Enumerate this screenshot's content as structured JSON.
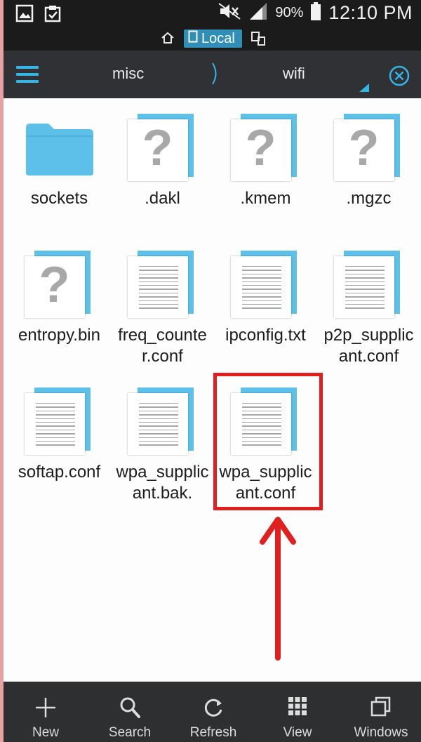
{
  "status_bar": {
    "battery_percent": "90%",
    "time": "12:10 PM",
    "icons": [
      "gallery-icon",
      "clipboard-icon",
      "mute-icon",
      "signal-icon",
      "battery-icon"
    ]
  },
  "location": {
    "label": "Local",
    "icons": [
      "home-icon",
      "storage-icon",
      "network-icon"
    ]
  },
  "path": {
    "segments": [
      "misc",
      "wifi"
    ]
  },
  "files": [
    {
      "name": "sockets",
      "type": "folder"
    },
    {
      "name": ".dakl",
      "type": "unknown"
    },
    {
      "name": ".kmem",
      "type": "unknown"
    },
    {
      "name": ".mgzc",
      "type": "unknown"
    },
    {
      "name": "entropy.bin",
      "type": "unknown"
    },
    {
      "name": "freq_counter.conf",
      "type": "text"
    },
    {
      "name": "ipconfig.txt",
      "type": "text"
    },
    {
      "name": "p2p_supplicant.conf",
      "type": "text"
    },
    {
      "name": "softap.conf",
      "type": "text"
    },
    {
      "name": "wpa_supplicant.bak.",
      "type": "text"
    },
    {
      "name": "wpa_supplicant.conf",
      "type": "text"
    }
  ],
  "toolbar": {
    "items": [
      {
        "label": "New",
        "icon": "plus-icon"
      },
      {
        "label": "Search",
        "icon": "search-icon"
      },
      {
        "label": "Refresh",
        "icon": "refresh-icon"
      },
      {
        "label": "View",
        "icon": "grid-view-icon"
      },
      {
        "label": "Windows",
        "icon": "windows-icon"
      }
    ]
  },
  "colors": {
    "accent": "#33b5e5",
    "highlight": "#e0201f",
    "folder": "#5cc0e8"
  }
}
